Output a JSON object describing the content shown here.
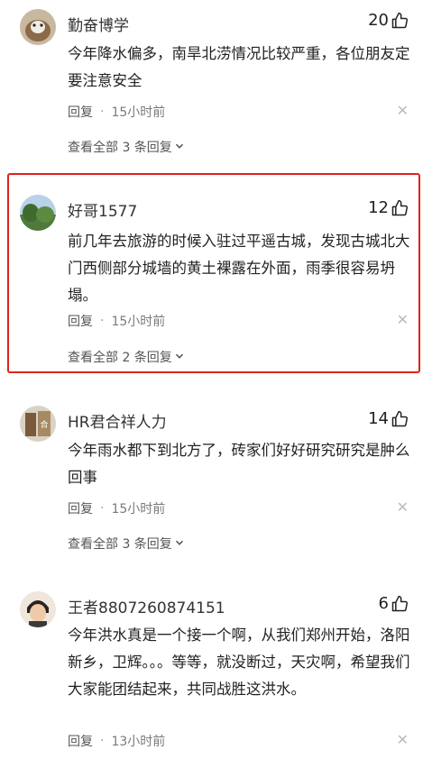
{
  "comments": [
    {
      "username": "勤奋博学",
      "likes": "20",
      "text": "今年降水偏多，南旱北涝情况比较严重，各位朋友定要注意安全",
      "reply_label": "回复",
      "separator": "·",
      "time": "15小时前",
      "view_all": "查看全部 3 条回复"
    },
    {
      "username": "好哥1577",
      "likes": "12",
      "text": "前几年去旅游的时候入驻过平遥古城，发现古城北大门西侧部分城墙的黄土裸露在外面，雨季很容易坍塌。",
      "reply_label": "回复",
      "separator": "·",
      "time": "15小时前",
      "view_all": "查看全部 2 条回复"
    },
    {
      "username": "HR君合祥人力",
      "likes": "14",
      "text": "今年雨水都下到北方了，砖家们好好研究研究是肿么回事",
      "reply_label": "回复",
      "separator": "·",
      "time": "15小时前",
      "view_all": "查看全部 3 条回复"
    },
    {
      "username": "王者8807260874151",
      "likes": "6",
      "text": "今年洪水真是一个接一个啊，从我们郑州开始，洛阳新乡，卫辉。。。等等，就没断过，天灾啊，希望我们大家能团结起来，共同战胜这洪水。",
      "reply_label": "回复",
      "separator": "·",
      "time": "13小时前"
    }
  ],
  "icons": {
    "like": "thumbs-up-icon",
    "close": "close-icon",
    "chevron": "chevron-down-icon"
  },
  "colors": {
    "highlight_border": "#e0231c",
    "meta_text": "#7a7a7a"
  }
}
